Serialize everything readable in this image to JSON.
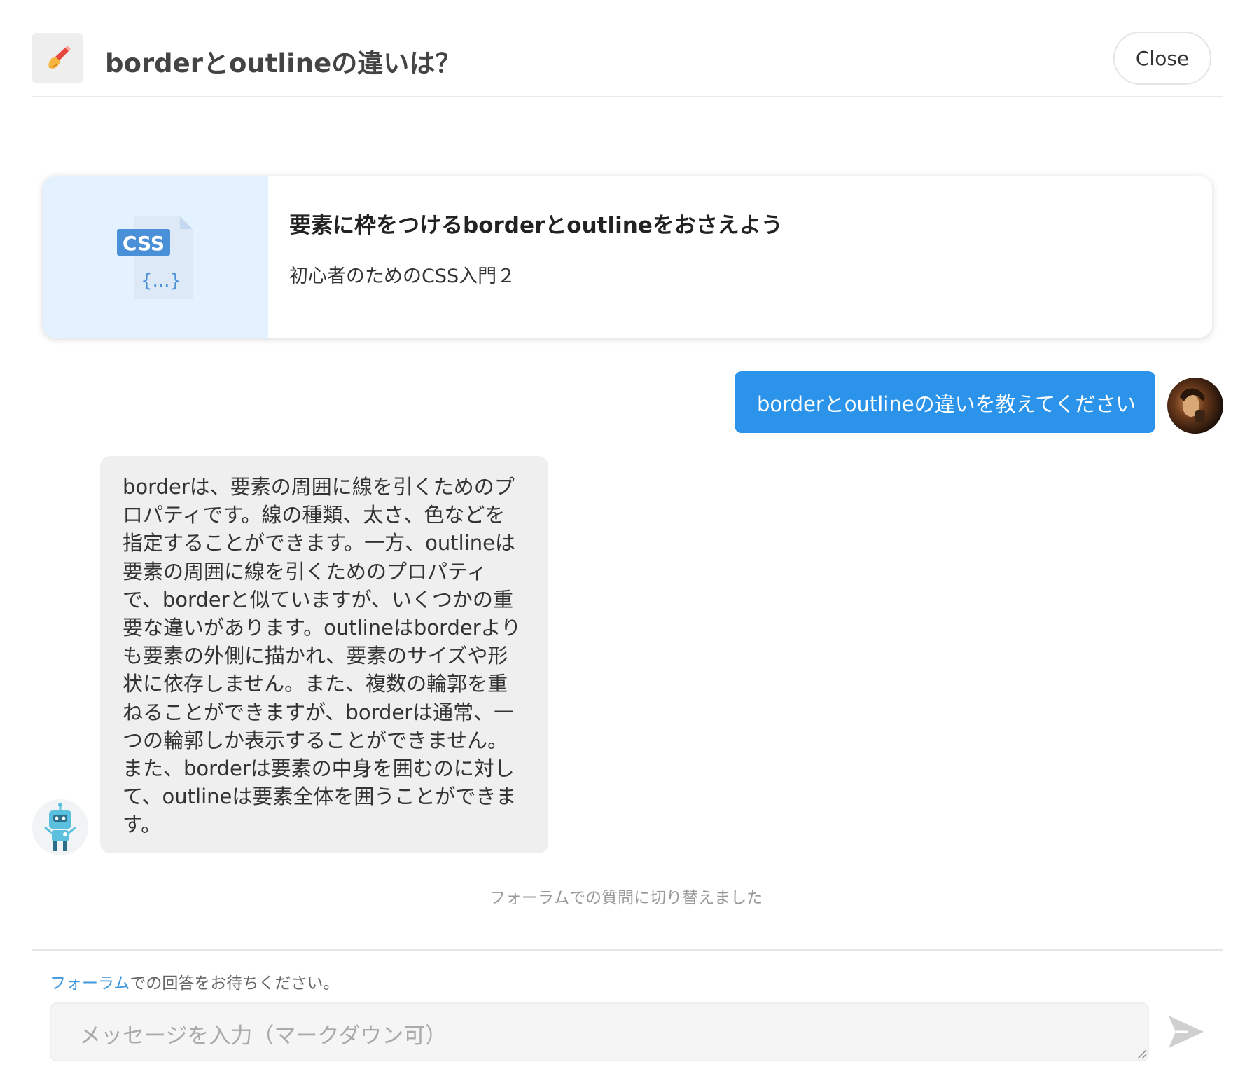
{
  "header": {
    "title": "borderとoutlineの違いは？",
    "close_label": "Close",
    "icon": "writing-hand-icon"
  },
  "course_card": {
    "title": "要素に枠をつけるborderとoutlineをおさえよう",
    "subtitle": "初心者のためのCSS入門２",
    "thumbnail_icon": "css-file-icon",
    "thumbnail_label": "CSS",
    "thumbnail_braces": "{...}"
  },
  "user_message": {
    "text": "borderとoutlineの違いを教えてください",
    "bubble_color": "#2b93ea"
  },
  "bot_message": {
    "lines": [
      "borderは、要素の周囲に線を引くためのプ",
      "ロパティです。線の種類、太さ、色などを",
      "指定することができます。一方、outlineは",
      "要素の周囲に線を引くためのプロパティ",
      "で、borderと似ていますが、いくつかの重",
      "要な違いがあります。outlineはborderより",
      "も要素の外側に描かれ、要素のサイズや形",
      "状に依存しません。また、複数の輪郭を重",
      "ねることができますが、borderは通常、一",
      "つの輪郭しか表示することができません。",
      "また、borderは要素の中身を囲むのに対し",
      "て、outlineは要素全体を囲うことができま",
      "す。"
    ]
  },
  "system_note": "フォーラムでの質問に切り替えました",
  "composer": {
    "hint_link": "フォーラム",
    "hint_rest": "での回答をお待ちください。",
    "placeholder": "メッセージを入力（マークダウン可）",
    "send_icon": "send-icon"
  }
}
